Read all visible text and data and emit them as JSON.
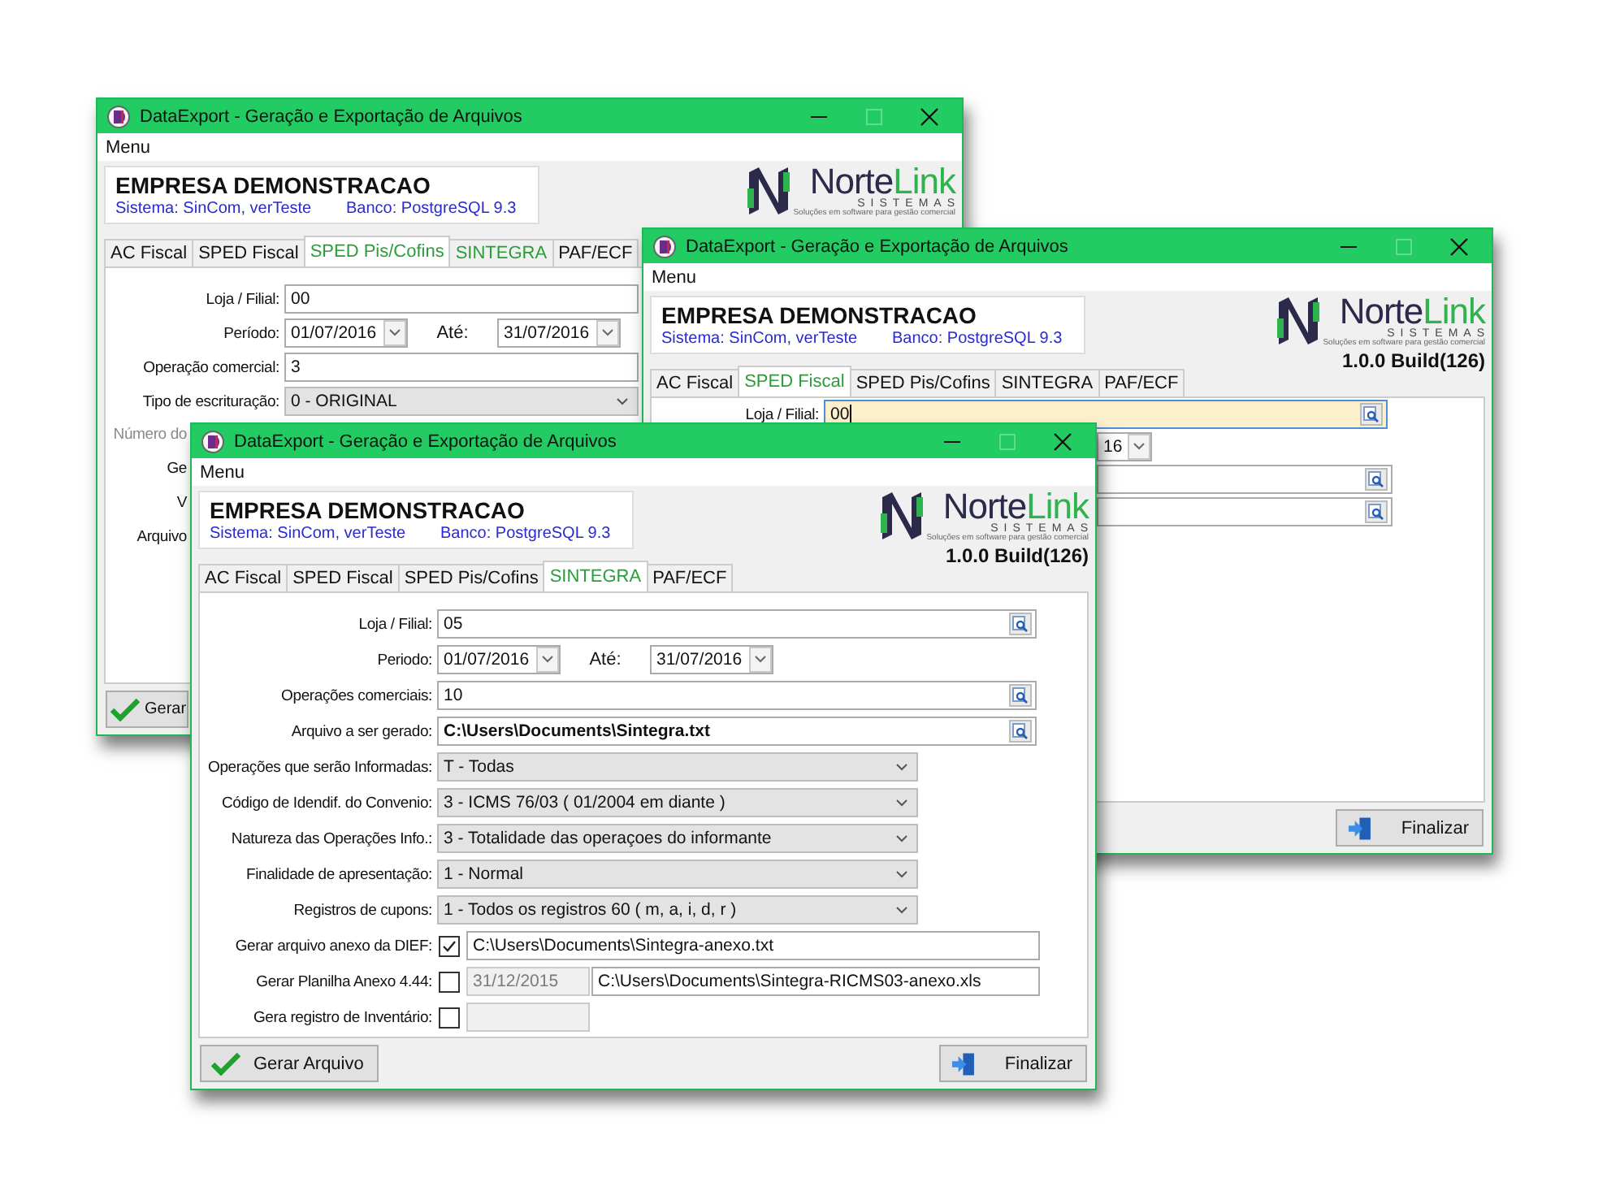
{
  "windows": [
    {
      "title": "DataExport - Geração e Exportação de Arquivos",
      "menu": "Menu",
      "company": "EMPRESA DEMONSTRACAO",
      "system": "Sistema: SinCom, verTeste",
      "database": "Banco: PostgreSQL 9.3",
      "logo": {
        "brand_a": "Norte",
        "brand_b": "Link",
        "subtitle": "SISTEMAS",
        "tagline": "Soluções em software para gestão comercial"
      },
      "tabs": [
        {
          "label": "AC Fiscal",
          "selected": false,
          "hovered": false
        },
        {
          "label": "SPED Fiscal",
          "selected": false,
          "hovered": false
        },
        {
          "label": "SPED Pis/Cofins",
          "selected": true,
          "hovered": false
        },
        {
          "label": "SINTEGRA",
          "selected": false,
          "hovered": true
        },
        {
          "label": "PAF/ECF",
          "selected": false,
          "hovered": false
        }
      ],
      "rows": [
        {
          "kind": "input",
          "label": "Loja / Filial:",
          "value": "00",
          "search": false,
          "focused": false,
          "bold": false
        },
        {
          "kind": "dates",
          "label": "Período:",
          "from": "01/07/2016",
          "to_label": "Até:",
          "to": "31/07/2016"
        },
        {
          "kind": "input",
          "label": "Operação comercial:",
          "value": "3",
          "search": false,
          "focused": false,
          "bold": false
        },
        {
          "kind": "select",
          "label": "Tipo de escrituração:",
          "value": "0 - ORIGINAL"
        },
        {
          "kind": "cut-label",
          "label": "Número do",
          "disabled": true
        },
        {
          "kind": "cut-label",
          "label": "Ge",
          "disabled": false
        },
        {
          "kind": "cut-label",
          "label": "V",
          "disabled": false
        },
        {
          "kind": "cut-label",
          "label": "Arquivo",
          "disabled": false
        }
      ],
      "buttons": [
        {
          "kind": "generate",
          "label": "Gerar"
        }
      ]
    },
    {
      "title": "DataExport - Geração e Exportação de Arquivos",
      "menu": "Menu",
      "company": "EMPRESA DEMONSTRACAO",
      "system": "Sistema: SinCom, verTeste",
      "database": "Banco: PostgreSQL 9.3",
      "logo": {
        "brand_a": "Norte",
        "brand_b": "Link",
        "subtitle": "SISTEMAS",
        "tagline": "Soluções em software para gestão comercial"
      },
      "version": "1.0.0 Build(126)",
      "tabs": [
        {
          "label": "AC Fiscal",
          "selected": false
        },
        {
          "label": "SPED Fiscal",
          "selected": true
        },
        {
          "label": "SPED Pis/Cofins",
          "selected": false
        },
        {
          "label": "SINTEGRA",
          "selected": false
        },
        {
          "label": "PAF/ECF",
          "selected": false
        }
      ],
      "rows": [
        {
          "kind": "input",
          "label": "Loja / Filial:",
          "value": "00",
          "search": true,
          "focused": true,
          "bold": false
        },
        {
          "kind": "tail",
          "value": "16"
        },
        {
          "kind": "input",
          "search": true,
          "focused": false,
          "bold": false
        },
        {
          "kind": "input",
          "search": true,
          "focused": false,
          "bold": false
        }
      ],
      "buttons": [
        {
          "kind": "finish",
          "label": "Finalizar"
        }
      ]
    },
    {
      "title": "DataExport - Geração e Exportação de Arquivos",
      "menu": "Menu",
      "company": "EMPRESA DEMONSTRACAO",
      "system": "Sistema: SinCom, verTeste",
      "database": "Banco: PostgreSQL 9.3",
      "logo": {
        "brand_a": "Norte",
        "brand_b": "Link",
        "subtitle": "SISTEMAS",
        "tagline": "Soluções em software para gestão comercial"
      },
      "version": "1.0.0 Build(126)",
      "tabs": [
        {
          "label": "AC Fiscal",
          "selected": false
        },
        {
          "label": "SPED Fiscal",
          "selected": false
        },
        {
          "label": "SPED Pis/Cofins",
          "selected": false
        },
        {
          "label": "SINTEGRA",
          "selected": true
        },
        {
          "label": "PAF/ECF",
          "selected": false
        }
      ],
      "rows": [
        {
          "kind": "input",
          "label": "Loja / Filial:",
          "value": "05",
          "search": true,
          "focused": false,
          "bold": false
        },
        {
          "kind": "dates",
          "label": "Periodo:",
          "from": "01/07/2016",
          "to_label": "Até:",
          "to": "31/07/2016"
        },
        {
          "kind": "input",
          "label": "Operações comerciais:",
          "value": "10",
          "search": true,
          "focused": false,
          "bold": false
        },
        {
          "kind": "input",
          "label": "Arquivo a ser gerado:",
          "value": "C:\\Users\\Documents\\Sintegra.txt",
          "search": true,
          "focused": false,
          "bold": true
        },
        {
          "kind": "select",
          "label": "Operações que serão Informadas:",
          "value": "T - Todas"
        },
        {
          "kind": "select",
          "label": "Código de Idendif. do Convenio:",
          "value": "3 - ICMS 76/03 ( 01/2004 em diante )"
        },
        {
          "kind": "select",
          "label": "Natureza das Operações Info.:",
          "value": "3 - Totalidade das operaçoes do informante"
        },
        {
          "kind": "select",
          "label": "Finalidade de apresentação:",
          "value": "1 - Normal"
        },
        {
          "kind": "select",
          "label": "Registros de cupons:",
          "value": "1 - Todos os registros 60 ( m, a, i, d, r )"
        },
        {
          "kind": "check",
          "label": "Gerar arquivo anexo da DIEF:",
          "checked": true,
          "fields": [
            {
              "kind": "path",
              "value": "C:\\Users\\Documents\\Sintegra-anexo.txt",
              "disabled": false
            }
          ]
        },
        {
          "kind": "check",
          "label": "Gerar Planilha Anexo 4.44:",
          "checked": false,
          "fields": [
            {
              "kind": "date",
              "value": "31/12/2015",
              "disabled": true
            },
            {
              "kind": "path",
              "value": "C:\\Users\\Documents\\Sintegra-RICMS03-anexo.xls",
              "disabled": false
            }
          ]
        },
        {
          "kind": "check",
          "label": "Gera registro de Inventário:",
          "checked": false,
          "fields": [
            {
              "kind": "date",
              "disabled": true
            }
          ]
        }
      ],
      "buttons": [
        {
          "kind": "generate",
          "label": "Gerar Arquivo"
        },
        {
          "kind": "finish",
          "label": "Finalizar"
        }
      ]
    }
  ]
}
